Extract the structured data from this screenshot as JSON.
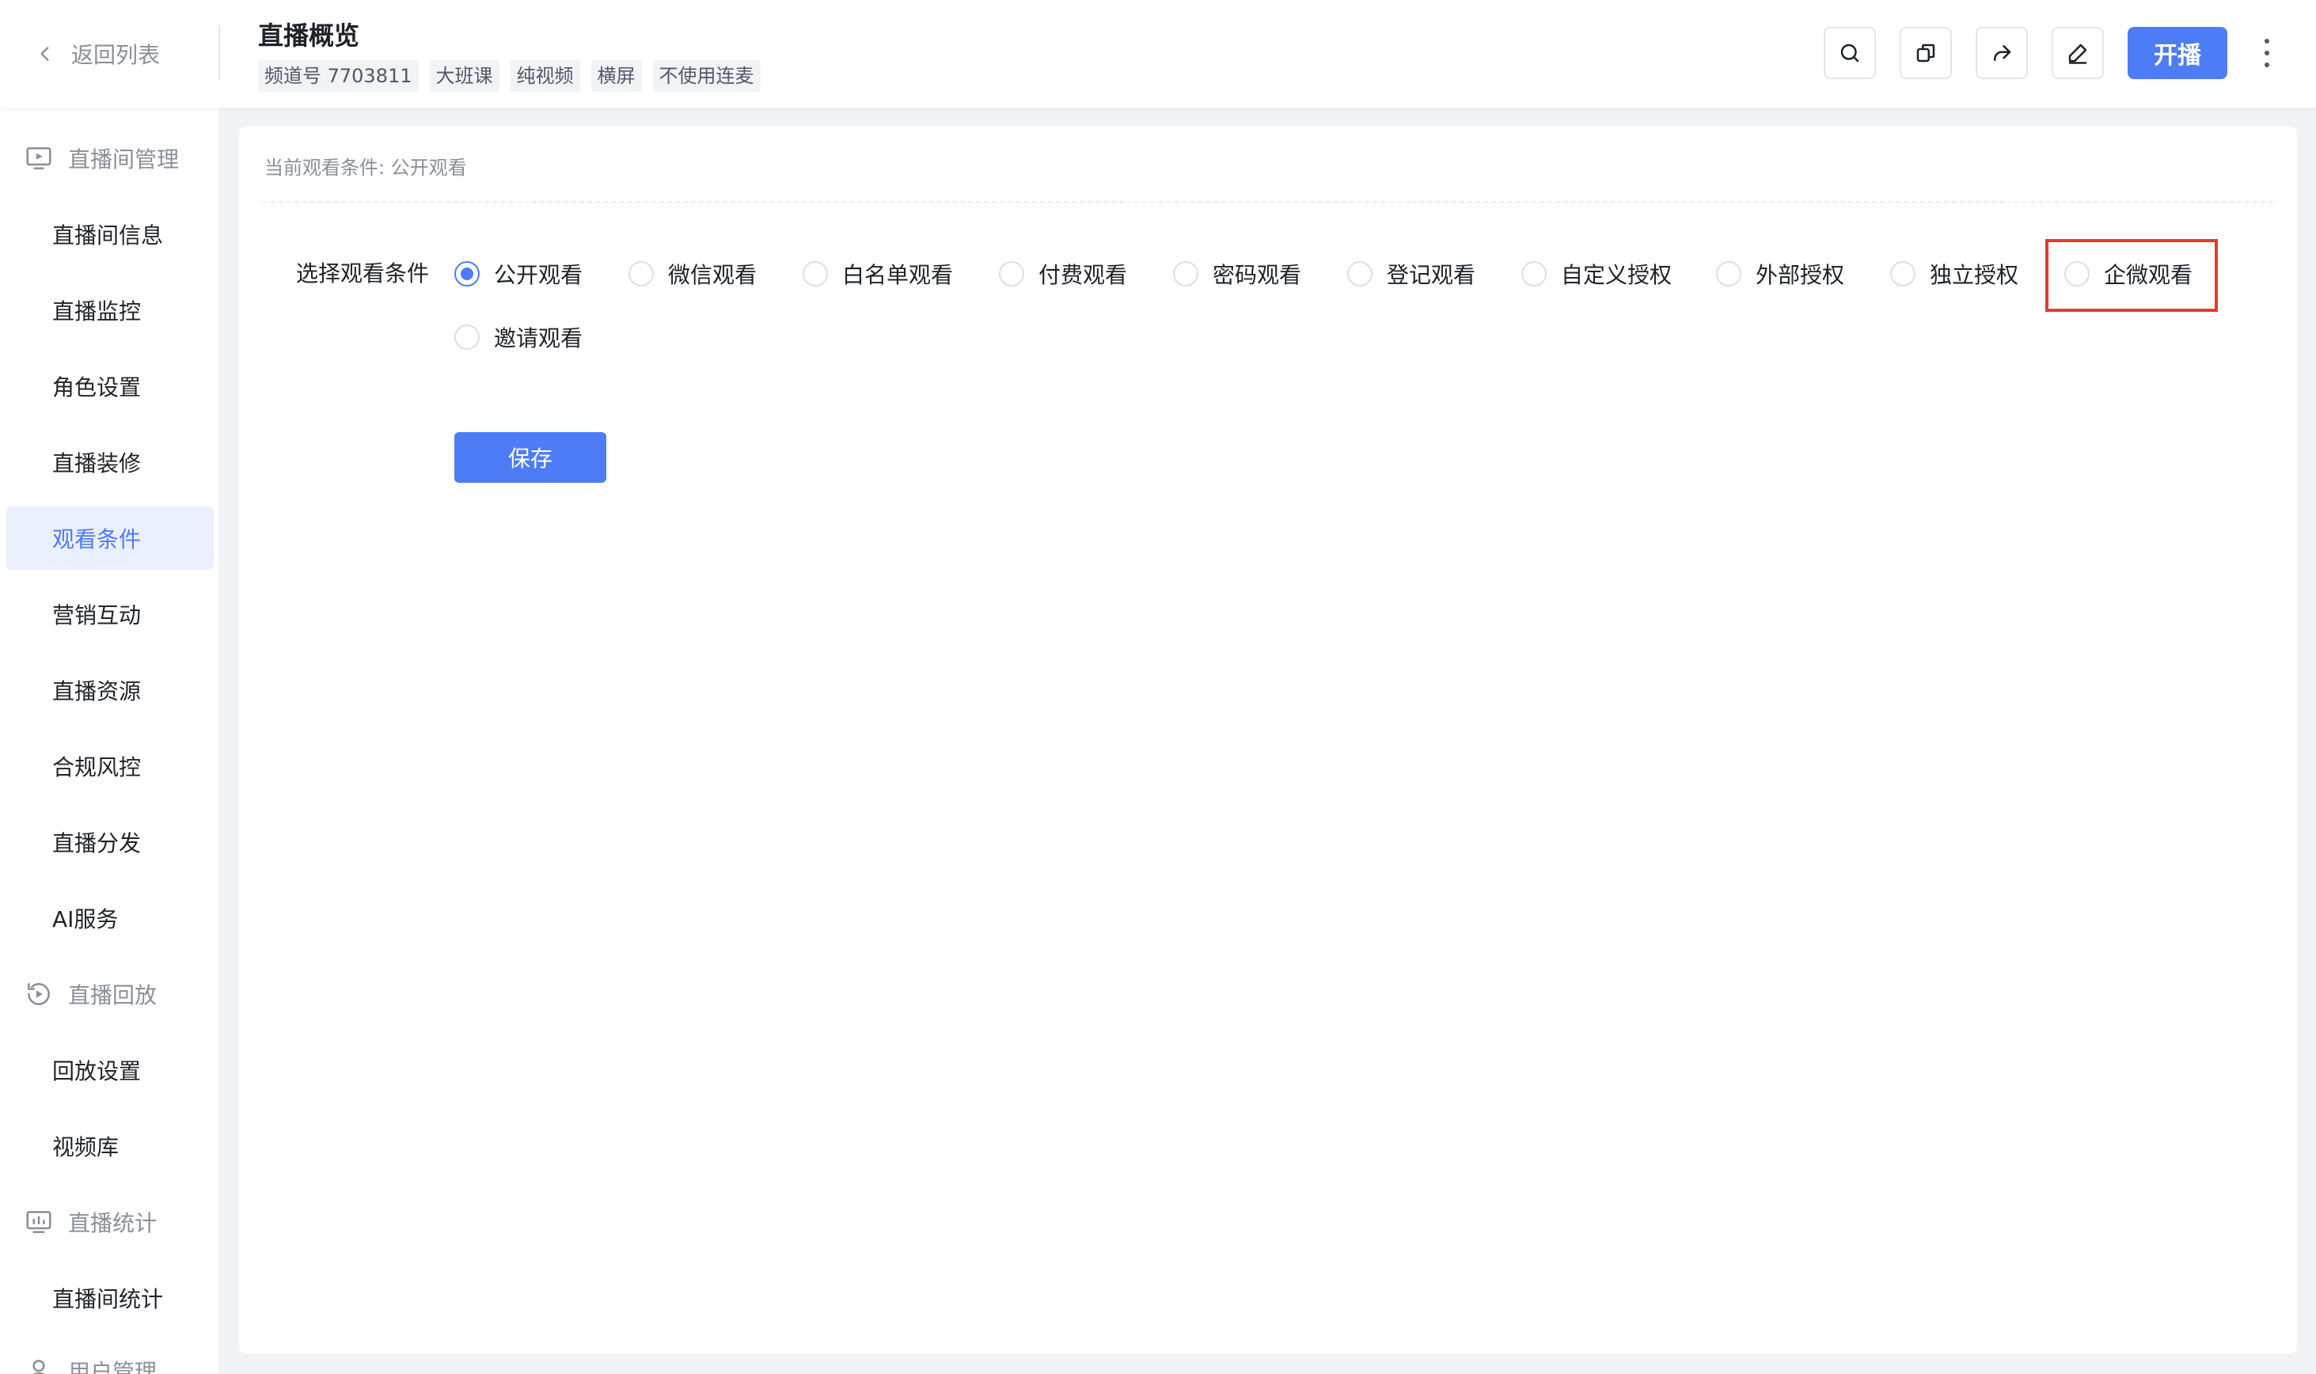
{
  "header": {
    "back_label": "返回列表",
    "title": "直播概览",
    "tags": [
      "频道号 7703811",
      "大班课",
      "纯视频",
      "横屏",
      "不使用连麦"
    ],
    "toolbar_icons": [
      "search-icon",
      "copy-icon",
      "share-icon",
      "edit-icon"
    ],
    "start_label": "开播"
  },
  "sidebar": {
    "groups": [
      {
        "label": "直播间管理",
        "icon": "live-room-icon",
        "items": [
          "直播间信息",
          "直播监控",
          "角色设置",
          "直播装修",
          "观看条件",
          "营销互动",
          "直播资源",
          "合规风控",
          "直播分发",
          "AI服务"
        ]
      },
      {
        "label": "直播回放",
        "icon": "replay-icon",
        "items": [
          "回放设置",
          "视频库"
        ]
      },
      {
        "label": "直播统计",
        "icon": "stats-icon",
        "items": [
          "直播间统计"
        ]
      },
      {
        "label": "用户管理",
        "icon": "user-icon",
        "items": []
      }
    ],
    "active_item": "观看条件"
  },
  "main": {
    "current_condition": "当前观看条件: 公开观看",
    "form_label": "选择观看条件",
    "options": [
      "公开观看",
      "微信观看",
      "白名单观看",
      "付费观看",
      "密码观看",
      "登记观看",
      "自定义授权",
      "外部授权",
      "独立授权",
      "企微观看",
      "邀请观看"
    ],
    "selected_option": "公开观看",
    "highlighted_option": "企微观看",
    "save_label": "保存"
  },
  "colors": {
    "accent": "#4e7cf7",
    "active_bg": "#ebf0fe",
    "highlight": "#e53935",
    "page_bg": "#f2f3f5"
  }
}
